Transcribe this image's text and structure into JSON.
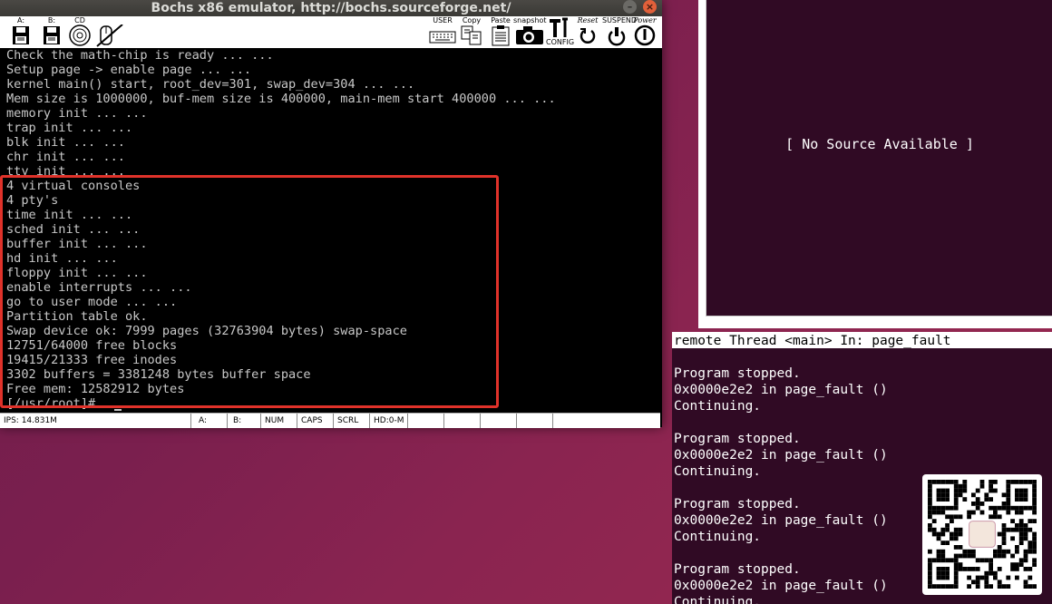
{
  "window": {
    "title": "Bochs x86 emulator, http://bochs.sourceforge.net/",
    "minimize_glyph": "–",
    "close_glyph": "×"
  },
  "toolbar": {
    "floppy_a_label": "A:",
    "floppy_b_label": "B:",
    "cdrom_label": "CD",
    "user_label": "USER",
    "copy_label": "Copy",
    "paste_label": "Paste",
    "snapshot_label": "snapshot",
    "config_label": "CONFIG",
    "reset_label": "Reset",
    "suspend_label": "SUSPEND",
    "power_label": "Power"
  },
  "console": {
    "lines": [
      "Check the math-chip is ready ... ...",
      "Setup page -> enable page ... ...",
      "kernel main() start, root_dev=301, swap_dev=304 ... ...",
      "Mem size is 1000000, buf-mem size is 400000, main-mem start 400000 ... ...",
      "memory init ... ...",
      "trap init ... ...",
      "blk init ... ...",
      "chr init ... ...",
      "tty init ... ...",
      "4 virtual consoles",
      "4 pty's",
      "time init ... ...",
      "sched init ... ...",
      "buffer init ... ...",
      "hd init ... ...",
      "floppy init ... ...",
      "enable interrupts ... ...",
      "go to user mode ... ...",
      "Partition table ok.",
      "Swap device ok: 7999 pages (32763904 bytes) swap-space",
      "12751/64000 free blocks",
      "19415/21333 free inodes",
      "3302 buffers = 3381248 bytes buffer space",
      "Free mem: 12582912 bytes",
      "[/usr/root]#"
    ]
  },
  "status_bar": {
    "ips": "IPS: 14.831M",
    "a": "A:",
    "b": "B:",
    "num": "NUM",
    "caps": "CAPS",
    "scrl": "SCRL",
    "hd": "HD:0-M"
  },
  "debugger": {
    "no_source": "[ No Source Available ]",
    "thread_status": "remote Thread <main> In: page_fault",
    "output_lines": [
      "Program stopped.",
      "0x0000e2e2 in page_fault ()",
      "Continuing.",
      "",
      "Program stopped.",
      "0x0000e2e2 in page_fault ()",
      "Continuing.",
      "",
      "Program stopped.",
      "0x0000e2e2 in page_fault ()",
      "Continuing.",
      "",
      "Program stopped.",
      "0x0000e2e2 in page_fault ()",
      "Continuing."
    ]
  },
  "colors": {
    "desktop": "#7a1f4e",
    "terminal_bg": "#300a24",
    "highlight": "#e0322a"
  }
}
